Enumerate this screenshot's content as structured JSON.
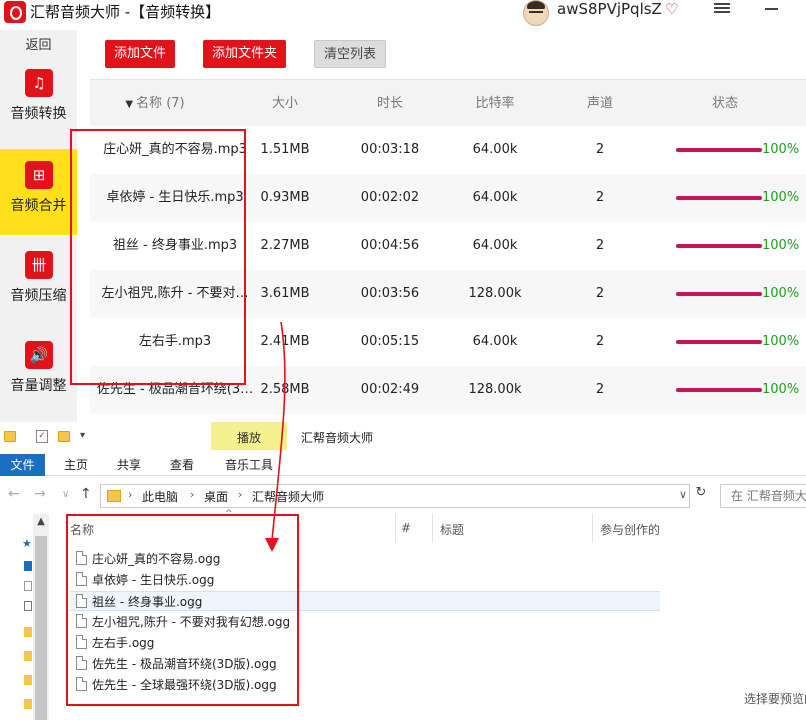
{
  "app": {
    "title": "汇帮音频大师  -【音频转换】",
    "username": "awS8PVjPqlsZ"
  },
  "sidebar": {
    "back_label": "返回",
    "items": [
      {
        "label": "音频转换",
        "icon": "convert-icon",
        "glyph": "♫"
      },
      {
        "label": "音频合并",
        "icon": "merge-icon",
        "glyph": "⊞"
      },
      {
        "label": "音频压缩",
        "icon": "compress-icon",
        "glyph": "卌"
      },
      {
        "label": "音量调整",
        "icon": "volume-icon",
        "glyph": "🔊"
      }
    ],
    "active_index": 1
  },
  "toolbar": {
    "add_file": "添加文件",
    "add_folder": "添加文件夹",
    "clear_list": "清空列表"
  },
  "table": {
    "headers": [
      "名称 (7)",
      "大小",
      "时长",
      "比特率",
      "声道",
      "状态"
    ],
    "rows": [
      {
        "name": "庄心妍_真的不容易.mp3",
        "size": "1.51MB",
        "duration": "00:03:18",
        "bitrate": "64.00k",
        "channels": "2",
        "progress": 1.0,
        "status": "100%"
      },
      {
        "name": "卓依婷 - 生日快乐.mp3",
        "size": "0.93MB",
        "duration": "00:02:02",
        "bitrate": "64.00k",
        "channels": "2",
        "progress": 1.0,
        "status": "100%"
      },
      {
        "name": "祖丝 - 终身事业.mp3",
        "size": "2.27MB",
        "duration": "00:04:56",
        "bitrate": "64.00k",
        "channels": "2",
        "progress": 1.0,
        "status": "100%"
      },
      {
        "name": "左小祖咒,陈升 - 不要对…",
        "size": "3.61MB",
        "duration": "00:03:56",
        "bitrate": "128.00k",
        "channels": "2",
        "progress": 1.0,
        "status": "100%"
      },
      {
        "name": "左右手.mp3",
        "size": "2.41MB",
        "duration": "00:05:15",
        "bitrate": "64.00k",
        "channels": "2",
        "progress": 1.0,
        "status": "100%"
      },
      {
        "name": "佐先生 - 极品潮音环绕(3…",
        "size": "2.58MB",
        "duration": "00:02:49",
        "bitrate": "128.00k",
        "channels": "2",
        "progress": 1.0,
        "status": "100%"
      }
    ],
    "status_color": "#19a51e",
    "bar_color": "#c2185b"
  },
  "explorer": {
    "ribbon_context_tab": "播放",
    "window_title": "汇帮音频大师",
    "ribbon_tabs": [
      "文件",
      "主页",
      "共享",
      "查看",
      "音乐工具"
    ],
    "breadcrumb": [
      "此电脑",
      "桌面",
      "汇帮音频大师"
    ],
    "search_placeholder": "在 汇帮音频大",
    "columns": [
      "名称",
      "#",
      "标题",
      "参与创作的"
    ],
    "files": [
      "庄心妍_真的不容易.ogg",
      "卓依婷 - 生日快乐.ogg",
      "祖丝 - 终身事业.ogg",
      "左小祖咒,陈升 - 不要对我有幻想.ogg",
      "左右手.ogg",
      "佐先生 - 极品潮音环绕(3D版).ogg",
      "佐先生 - 全球最强环绕(3D版).ogg"
    ],
    "selected_index": 2,
    "preview_hint": "选择要预览的"
  },
  "colors": {
    "brand_red": "#e2121a",
    "active_yellow": "#ffe01a",
    "annotation_red": "#e2121a"
  }
}
